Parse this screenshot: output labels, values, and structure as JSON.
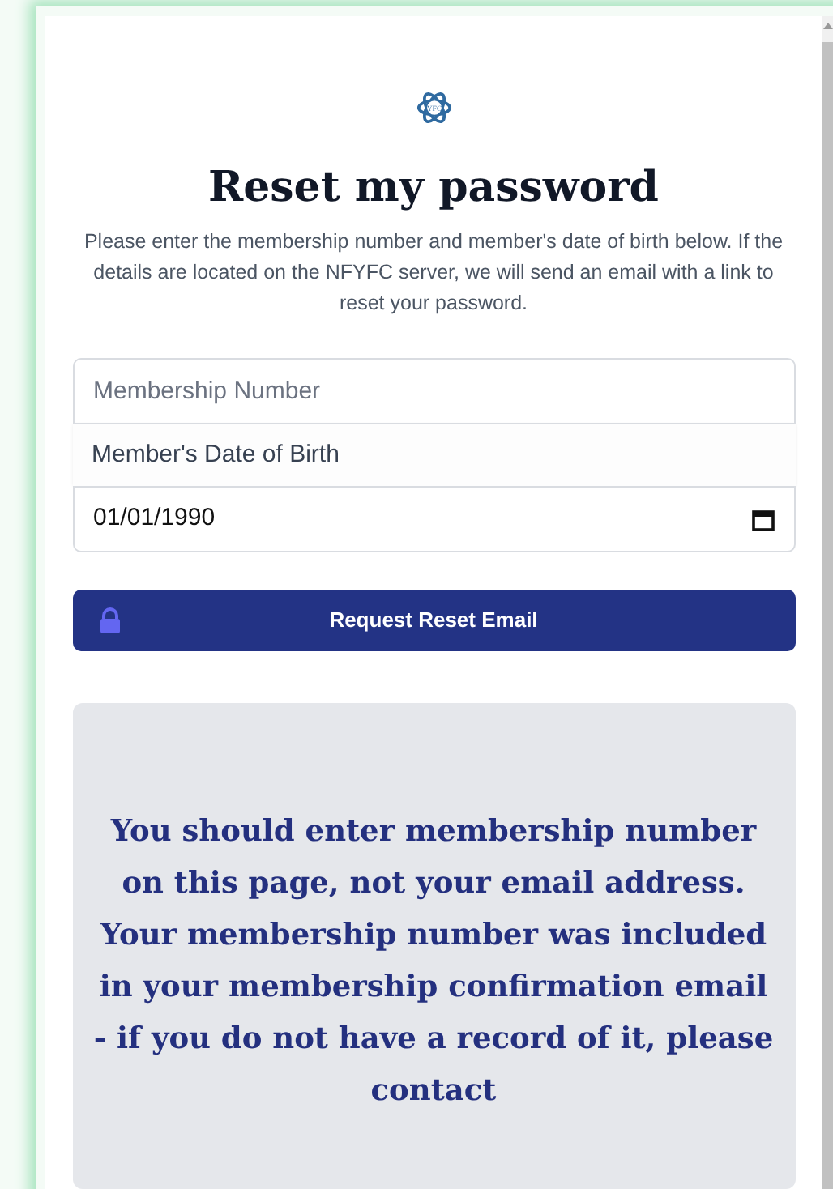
{
  "logo": {
    "text": "YFC"
  },
  "title": "Reset my password",
  "intro": "Please enter the membership number and member's date of birth below. If the details are located on the NFYFC server, we will send an email with a link to reset your password.",
  "membership_field": {
    "placeholder": "Membership Number"
  },
  "dob_label": "Member's Date of Birth",
  "dob_field": {
    "value": "01/01/1990"
  },
  "submit_button": {
    "label": "Request Reset Email"
  },
  "notice": "You should enter membership number on this page, not your email address. Your membership number was included in your membership confirmation email - if you do not have a record of it, please contact"
}
